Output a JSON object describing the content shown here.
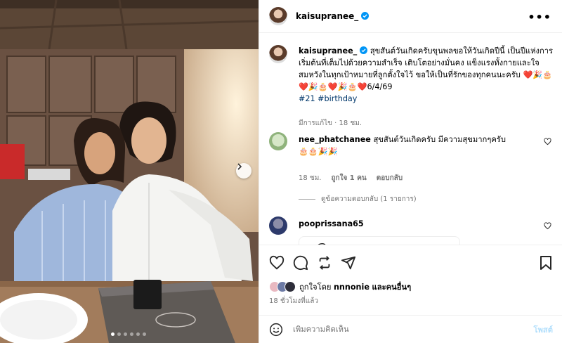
{
  "post": {
    "username": "kaisupranee_",
    "more_icon": "more-dots-icon"
  },
  "caption": {
    "username": "kaisupranee_",
    "text": "สุขสันต์วันเกิดครับขุนพลขอให้วันเกิดปีนี้ เป็นปีแห่งการเริ่มต้นที่เต็มไปด้วยความสำเร็จ เติบโตอย่างมั่นคง แข็งแรงทั้งกายและใจ สมหวังในทุกเป้าหมายที่ลูกตั้งใจไว้ ขอให้เป็นที่รักของทุกคนนะครับ ❤️🎉🎂❤️🎉🎂❤️🎉🎂❤️6/4/69",
    "hashtags": "#21 #birthday",
    "meta": "มีการแก้ไข · 18 ชม."
  },
  "comments": [
    {
      "username": "nee_phatchanee",
      "text": "สุขสันต์วันเกิดครับ มีความสุขมากๆครับ",
      "emoji_line": "🎂🎂🎉🎉",
      "time": "18 ชม.",
      "likes": "ถูกใจ 1 คน",
      "reply": "ตอบกลับ",
      "view_replies": "ดูข้อความตอบกลับ (1 รายการ)"
    },
    {
      "username": "pooprissana65",
      "text": ""
    }
  ],
  "likes": {
    "liked_by_prefix": "ถูกใจโดย",
    "liked_by_user": "nnnonie",
    "liked_by_suffix": "และคนอื่นๆ"
  },
  "time_ago": "18 ชั่วโมงที่แล้ว",
  "composer": {
    "placeholder": "เพิ่มความคิดเห็น",
    "post_label": "โพสต์",
    "emoji_icon": "emoji-icon"
  },
  "carousel": {
    "dots": 6,
    "active_index": 0
  },
  "colors": {
    "verified": "#0095f6",
    "link": "#00376b",
    "muted": "#737373",
    "post_disabled": "#b2dffc",
    "heart": "#ed4956"
  }
}
